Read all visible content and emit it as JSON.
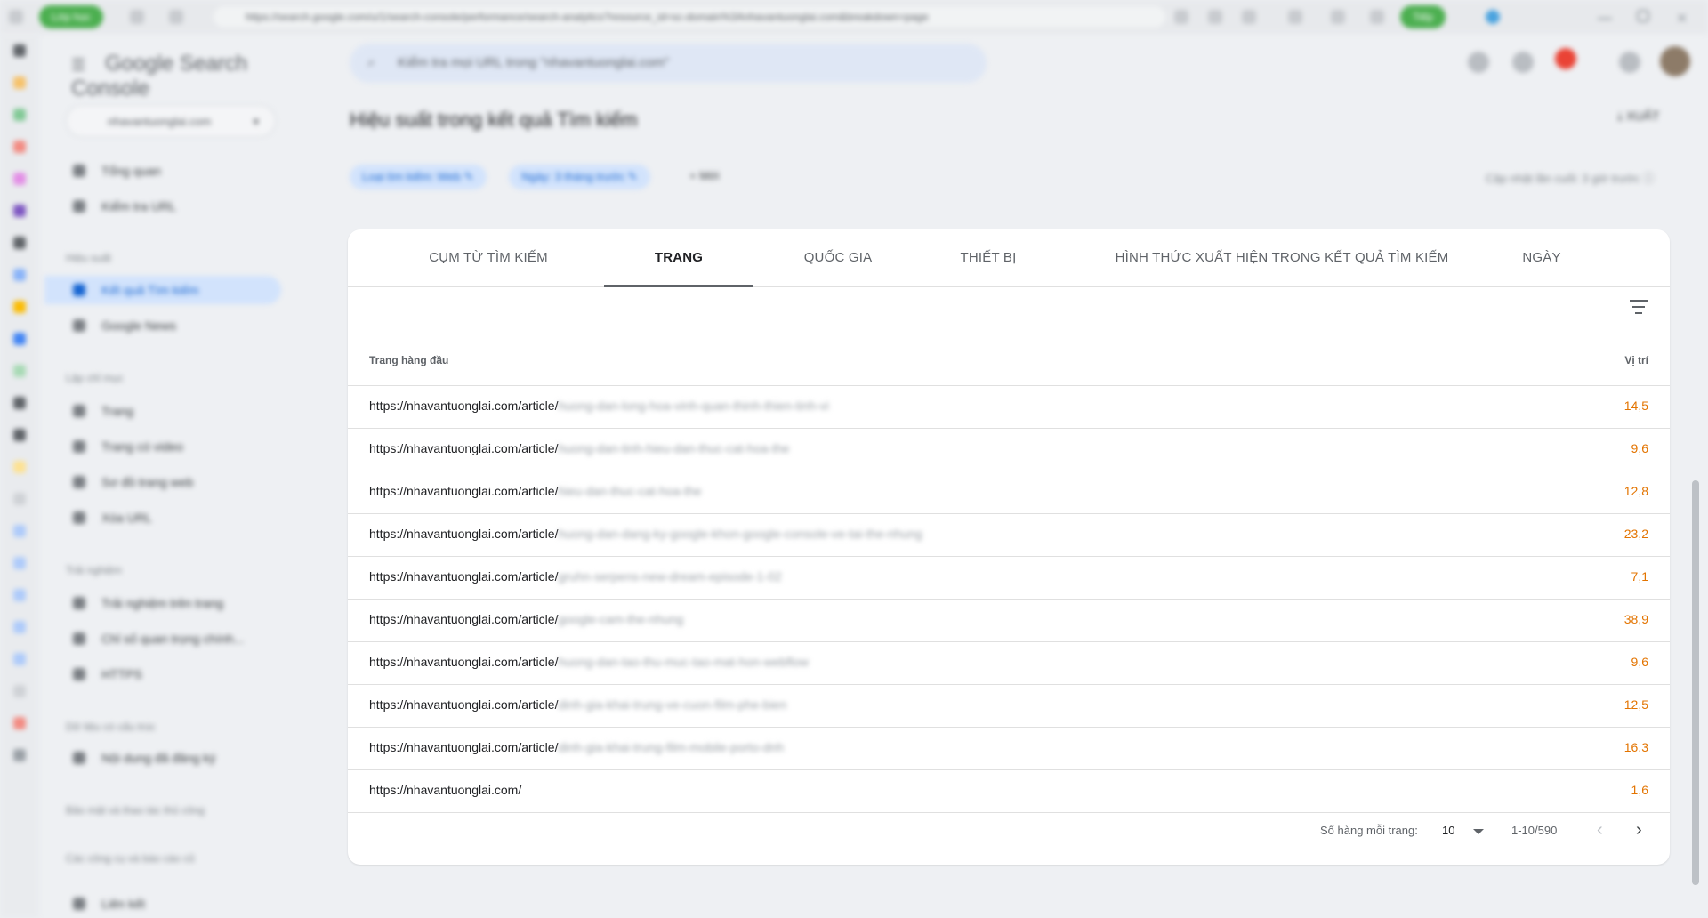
{
  "browser": {
    "tab_label": "Lớp học",
    "url": "https://search.google.com/u/1/search-console/performance/search-analytics?resource_id=sc-domain%3Anhavantuonglai.com&breakdown=page",
    "profile_label": "Tiếp"
  },
  "app": {
    "logo_text": "Google Search Console",
    "property": "nhavantuonglai.com",
    "search_placeholder": "Kiểm tra mọi URL trong \"nhavantuonglai.com\""
  },
  "sidebar": {
    "items": [
      {
        "label": "Tổng quan"
      },
      {
        "label": "Kiểm tra URL"
      },
      {
        "label": "Kết quả Tìm kiếm"
      },
      {
        "label": "Google News"
      },
      {
        "label": "Trang"
      },
      {
        "label": "Trang có video"
      },
      {
        "label": "Sơ đồ trang web"
      },
      {
        "label": "Xóa URL"
      },
      {
        "label": "Trải nghiệm trên trang"
      },
      {
        "label": "Chỉ số quan trọng chính..."
      },
      {
        "label": "HTTPS"
      },
      {
        "label": "Nội dung đã đăng ký"
      },
      {
        "label": "Liên kết"
      }
    ],
    "sections": [
      {
        "label": "Hiệu suất"
      },
      {
        "label": "Lập chỉ mục"
      },
      {
        "label": "Trải nghiệm"
      },
      {
        "label": "Dữ liệu có cấu trúc"
      },
      {
        "label": "Bảo mật và thao tác thủ công"
      },
      {
        "label": "Các công cụ và báo cáo cũ"
      }
    ]
  },
  "header": {
    "title": "Hiệu suất trong kết quả Tìm kiếm",
    "export_label": "XUẤT",
    "filters": [
      {
        "label": "Loại tìm kiếm: Web"
      },
      {
        "label": "Ngày: 3 tháng trước"
      }
    ],
    "add_filter_label": "Mới",
    "last_update": "Cập nhật lần cuối: 3 giờ trước"
  },
  "tabs": [
    {
      "label": "CỤM TỪ TÌM KIẾM"
    },
    {
      "label": "TRANG"
    },
    {
      "label": "QUỐC GIA"
    },
    {
      "label": "THIẾT BỊ"
    },
    {
      "label": "HÌNH THỨC XUẤT HIỆN TRONG KẾT QUẢ TÌM KIẾM"
    },
    {
      "label": "NGÀY"
    }
  ],
  "active_tab": "TRANG",
  "table": {
    "col_page": "Trang hàng đầu",
    "col_position": "Vị trí",
    "rows": [
      {
        "url": "https://nhavantuonglai.com/article/",
        "slug": "huong-dan-long-hoa-vinh-quan-thinh-thien-tinh-vi",
        "position": "14,5"
      },
      {
        "url": "https://nhavantuonglai.com/article/",
        "slug": "huong-dan-tinh-hieu-dan-thuc-cat-hoa-the",
        "position": "9,6"
      },
      {
        "url": "https://nhavantuonglai.com/article/",
        "slug": "hieu-dan-thuc-cat-hoa-the",
        "position": "12,8"
      },
      {
        "url": "https://nhavantuonglai.com/article/",
        "slug": "huong-dan-dang-ky-google-khon-google-console-ve-tai-the-nhung",
        "position": "23,2"
      },
      {
        "url": "https://nhavantuonglai.com/article/",
        "slug": "gruhn-serpens-new-dream-episode-1-02",
        "position": "7,1"
      },
      {
        "url": "https://nhavantuonglai.com/article/",
        "slug": "google-cam-the-nhung",
        "position": "38,9"
      },
      {
        "url": "https://nhavantuonglai.com/article/",
        "slug": "huong-dan-tao-thu-muc-tao-mat-hon-webflow",
        "position": "9,6"
      },
      {
        "url": "https://nhavantuonglai.com/article/",
        "slug": "dinh-gia-khai-trung-ve-cuon-film-phe-bien",
        "position": "12,5"
      },
      {
        "url": "https://nhavantuonglai.com/article/",
        "slug": "dinh-gia-khai-trung-film-mobile-porto-dnh",
        "position": "16,3"
      },
      {
        "url": "https://nhavantuonglai.com/",
        "slug": "",
        "position": "1,6"
      }
    ]
  },
  "pagination": {
    "rows_per_page_label": "Số hàng mỗi trang:",
    "rows_per_page_value": "10",
    "range": "1-10/590"
  }
}
